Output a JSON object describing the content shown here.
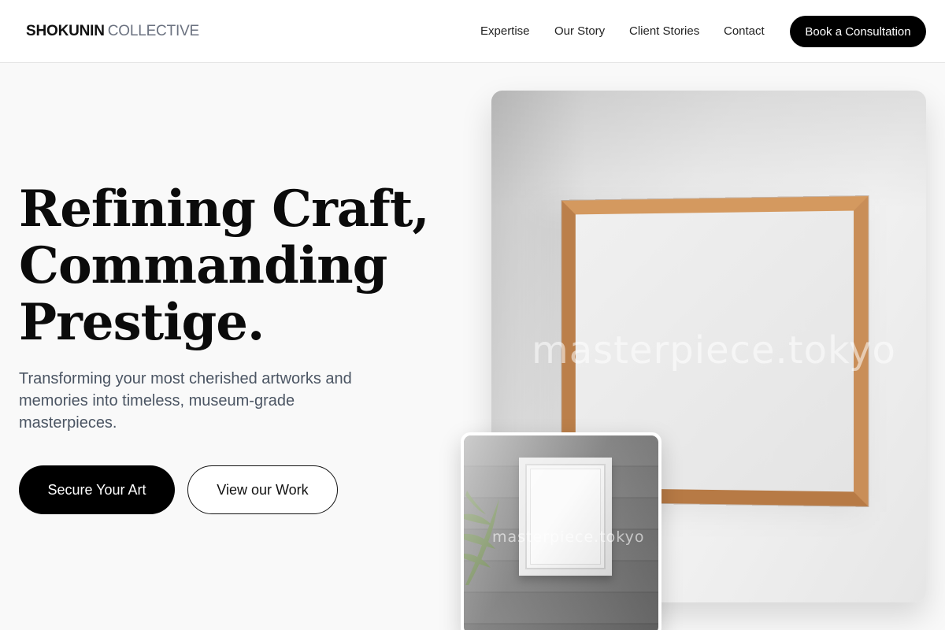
{
  "header": {
    "brand_strong": "SHOKUNIN",
    "brand_light": "COLLECTIVE",
    "nav": [
      "Expertise",
      "Our Story",
      "Client Stories",
      "Contact"
    ],
    "cta": "Book a Consultation"
  },
  "hero": {
    "title_lines": [
      "Refining Craft,",
      "Commanding",
      "Prestige."
    ],
    "subtitle": "Transforming your most cherished artworks and memories into timeless, museum-grade masterpieces.",
    "primary_button": "Secure Your Art",
    "secondary_button": "View our Work"
  },
  "images": {
    "main_watermark": "masterpiece.tokyo",
    "thumb_watermark": "masterpiece.tokyo"
  },
  "colors": {
    "background": "#f9f9f9",
    "accent": "#000000",
    "muted_text": "#4b5563",
    "wood": "#c58a55"
  }
}
